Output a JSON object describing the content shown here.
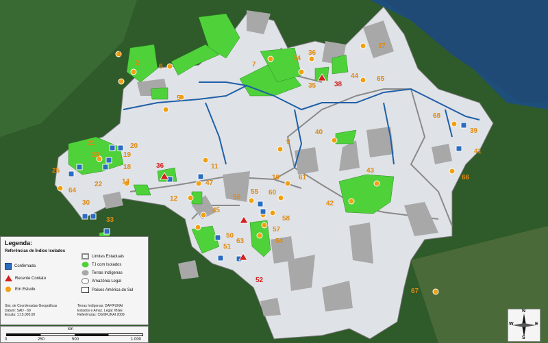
{
  "colors": {
    "ocean": "#1d4f7a",
    "forest": "#2f5a2a",
    "amazonia_legal": "#dfe2e6",
    "indigenous_land": "#a8a8a8",
    "isolated_land": "#4fd13a",
    "river": "#1f5fa8",
    "state_border": "#8a8a8a",
    "confirmed_marker": "#2a6cc0",
    "recent_contact": "#d42020",
    "study_marker": "#f0a010"
  },
  "map_labels": [
    {
      "text": "1",
      "kind": "study"
    },
    {
      "text": "2",
      "kind": "study"
    },
    {
      "text": "6",
      "kind": "study"
    },
    {
      "text": "7",
      "kind": "study"
    },
    {
      "text": "34",
      "kind": "study"
    },
    {
      "text": "36",
      "kind": "study"
    },
    {
      "text": "37",
      "kind": "study"
    },
    {
      "text": "44",
      "kind": "study"
    },
    {
      "text": "65",
      "kind": "study"
    },
    {
      "text": "35",
      "kind": "study"
    },
    {
      "text": "38",
      "kind": "recent"
    },
    {
      "text": "5",
      "kind": "study"
    },
    {
      "text": "68",
      "kind": "study"
    },
    {
      "text": "39",
      "kind": "study"
    },
    {
      "text": "40",
      "kind": "study"
    },
    {
      "text": "41",
      "kind": "study"
    },
    {
      "text": "9",
      "kind": "study"
    },
    {
      "text": "11",
      "kind": "study"
    },
    {
      "text": "43",
      "kind": "study"
    },
    {
      "text": "66",
      "kind": "study"
    },
    {
      "text": "61",
      "kind": "study"
    },
    {
      "text": "10",
      "kind": "study"
    },
    {
      "text": "42",
      "kind": "study"
    },
    {
      "text": "20",
      "kind": "study"
    },
    {
      "text": "21",
      "kind": "study"
    },
    {
      "text": "23",
      "kind": "study"
    },
    {
      "text": "19",
      "kind": "study"
    },
    {
      "text": "18",
      "kind": "study"
    },
    {
      "text": "25",
      "kind": "study"
    },
    {
      "text": "22",
      "kind": "study"
    },
    {
      "text": "14",
      "kind": "study"
    },
    {
      "text": "36",
      "kind": "recent"
    },
    {
      "text": "47",
      "kind": "study"
    },
    {
      "text": "64",
      "kind": "study"
    },
    {
      "text": "12",
      "kind": "study"
    },
    {
      "text": "56",
      "kind": "study"
    },
    {
      "text": "55",
      "kind": "study"
    },
    {
      "text": "60",
      "kind": "study"
    },
    {
      "text": "58",
      "kind": "study"
    },
    {
      "text": "45",
      "kind": "study"
    },
    {
      "text": "57",
      "kind": "study"
    },
    {
      "text": "30",
      "kind": "study"
    },
    {
      "text": "33",
      "kind": "study"
    },
    {
      "text": "50",
      "kind": "study"
    },
    {
      "text": "63",
      "kind": "study"
    },
    {
      "text": "54",
      "kind": "study"
    },
    {
      "text": "51",
      "kind": "study"
    },
    {
      "text": "52",
      "kind": "recent"
    },
    {
      "text": "67",
      "kind": "study"
    }
  ],
  "legend": {
    "title": "Legenda:",
    "subtitle": "Referências de Índios Isolados",
    "items": [
      {
        "label": "Confirmada",
        "symbol": "confirmed-marker"
      },
      {
        "label": "Recente Contato",
        "symbol": "triangle-marker"
      },
      {
        "label": "Em Estudo",
        "symbol": "study-marker"
      },
      {
        "label": "Limites Estaduais",
        "symbol": "state-limit"
      },
      {
        "label": "T.I com Isolados",
        "symbol": "isolated-land"
      },
      {
        "label": "Terras Indígenas",
        "symbol": "indigenous-land"
      },
      {
        "label": "Amazônia Legal",
        "symbol": "amazonia-legal"
      },
      {
        "label": "Países América do Sul",
        "symbol": "countries"
      }
    ],
    "meta_left": [
      "Sist. de Coordenadas Geográficas",
      "Datum: SAD - 69",
      "Escala: 1:15.000.00"
    ],
    "meta_right": [
      "Terras Indígenas: DAF/FUNAI",
      "Estados e Amaz. Legal: IBGE",
      "Referências: CGII/FUNAI 2009"
    ]
  },
  "scale": {
    "unit": "km",
    "ticks": [
      "0",
      "250",
      "500",
      "1.000"
    ]
  },
  "compass": {
    "n": "N",
    "s": "S",
    "e": "E",
    "w": "W"
  }
}
